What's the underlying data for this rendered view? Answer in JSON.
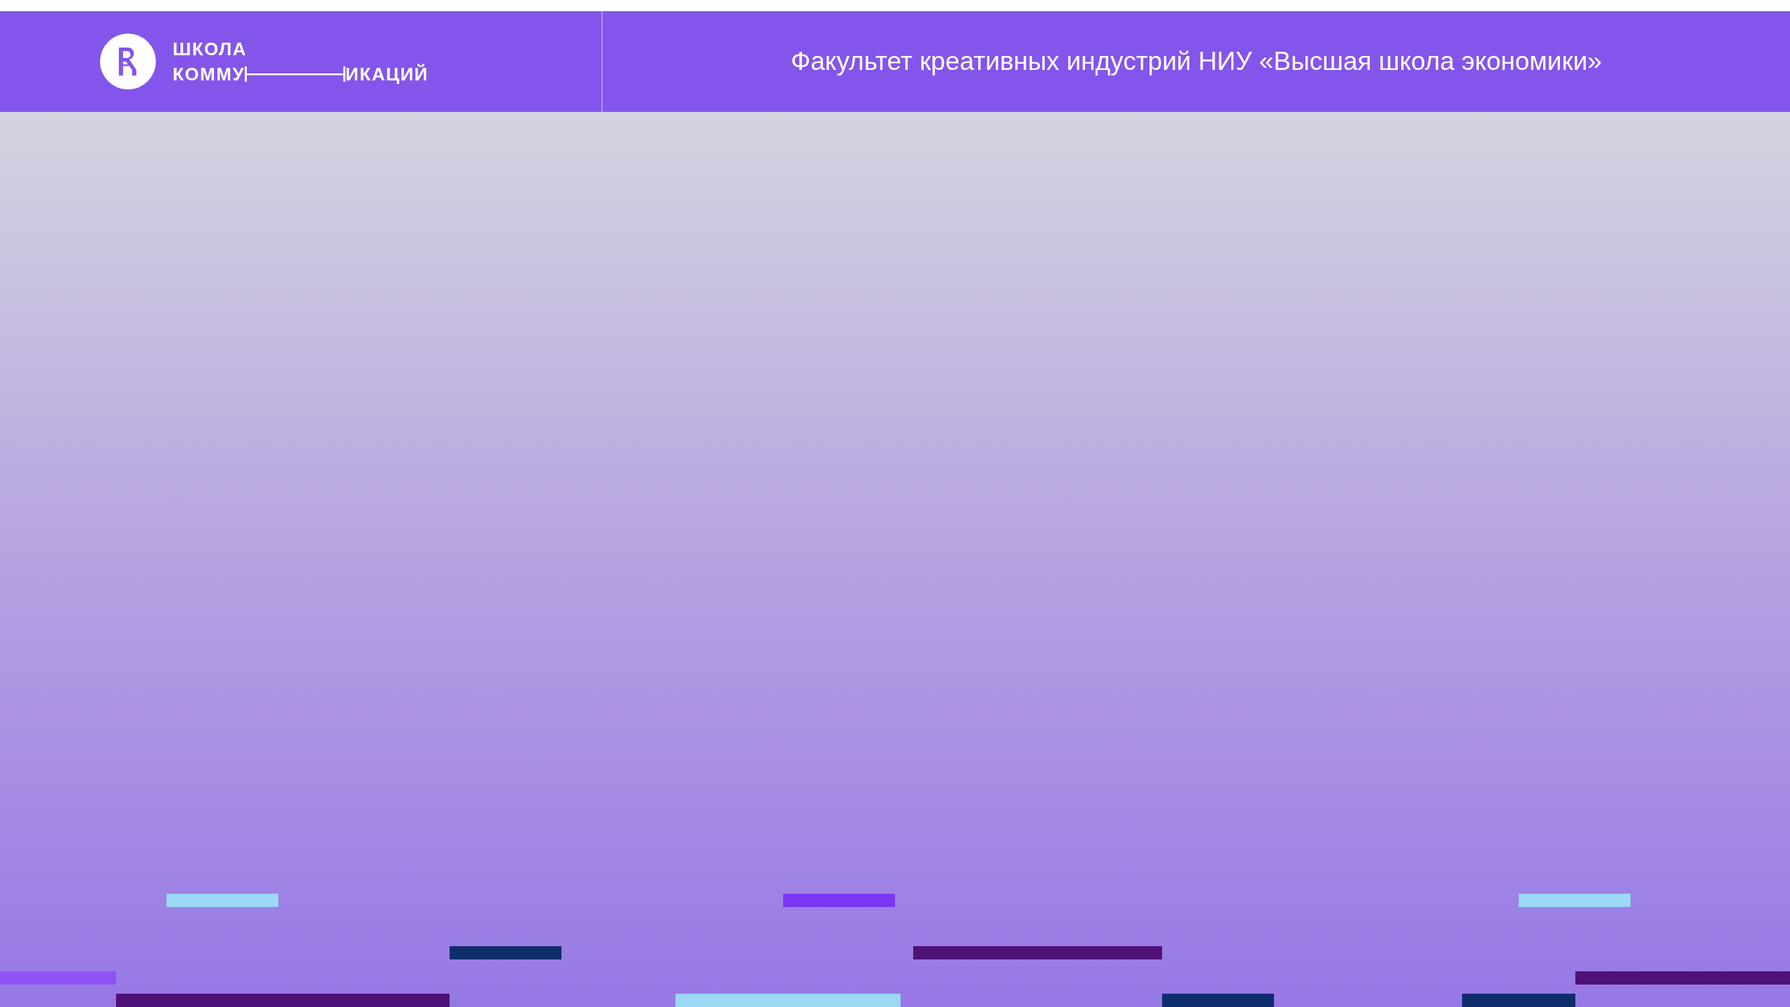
{
  "header": {
    "logo": {
      "line_1": "ШКОЛА",
      "line_2_left": "КОММУ",
      "line_2_right": "ИКАЦИЙ"
    },
    "title": "Факультет креативных индустрий НИУ «Высшая школа экономики»"
  }
}
